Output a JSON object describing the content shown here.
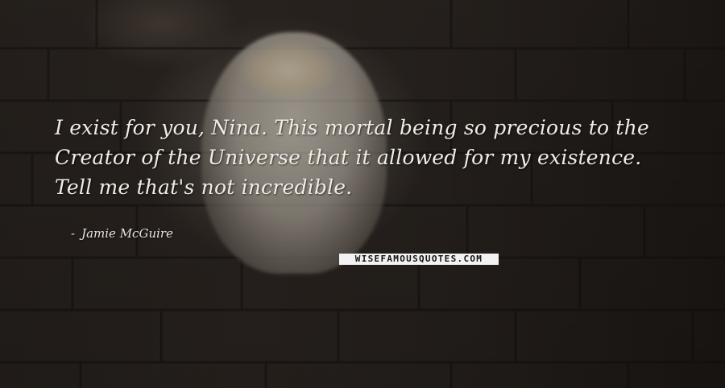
{
  "quote": {
    "lines": [
      "I exist for you, Nina. This mortal being so precious to the",
      "Creator of the Universe that it allowed for my existence.",
      "Tell me that's not incredible."
    ]
  },
  "author": {
    "dash": "-",
    "name": "Jamie McGuire"
  },
  "brand": {
    "text": "WISEFAMOUSQUOTES.COM"
  },
  "colors": {
    "text": "#f0ede6",
    "brand_bg": "#f2f2f2",
    "background": "#2b2521"
  }
}
